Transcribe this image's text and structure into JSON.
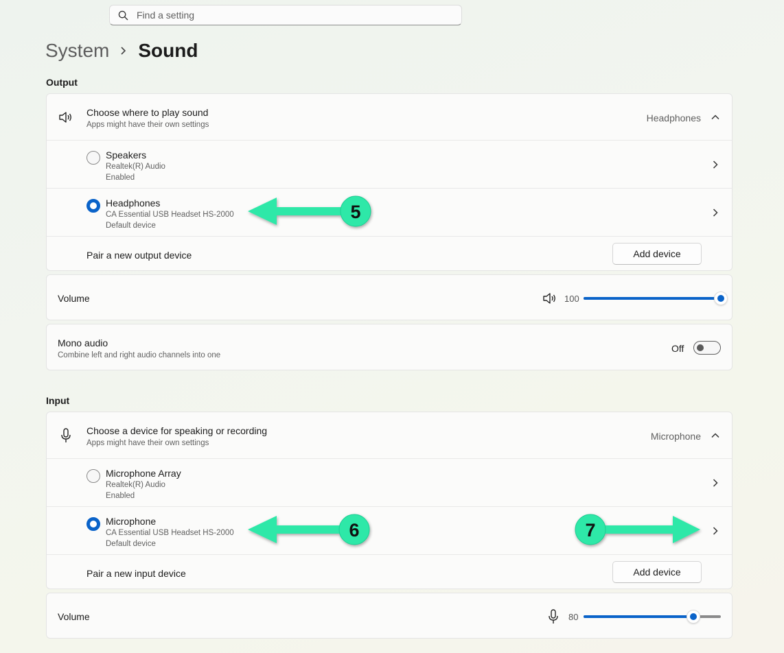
{
  "search": {
    "placeholder": "Find a setting"
  },
  "breadcrumb": {
    "parent": "System",
    "current": "Sound"
  },
  "output": {
    "section_label": "Output",
    "choose": {
      "title": "Choose where to play sound",
      "subtitle": "Apps might have their own settings",
      "value": "Headphones"
    },
    "devices": [
      {
        "name": "Speakers",
        "driver": "Realtek(R) Audio",
        "status": "Enabled",
        "selected": false
      },
      {
        "name": "Headphones",
        "driver": "CA Essential USB Headset HS-2000",
        "status": "Default device",
        "selected": true
      }
    ],
    "pair": {
      "label": "Pair a new output device",
      "button": "Add device"
    },
    "volume": {
      "label": "Volume",
      "value": "100",
      "level": 100
    },
    "mono": {
      "title": "Mono audio",
      "subtitle": "Combine left and right audio channels into one",
      "state": "Off"
    }
  },
  "input": {
    "section_label": "Input",
    "choose": {
      "title": "Choose a device for speaking or recording",
      "subtitle": "Apps might have their own settings",
      "value": "Microphone"
    },
    "devices": [
      {
        "name": "Microphone Array",
        "driver": "Realtek(R) Audio",
        "status": "Enabled",
        "selected": false
      },
      {
        "name": "Microphone",
        "driver": "CA Essential USB Headset HS-2000",
        "status": "Default device",
        "selected": true
      }
    ],
    "pair": {
      "label": "Pair a new input device",
      "button": "Add device"
    },
    "volume": {
      "label": "Volume",
      "value": "80",
      "level": 80
    }
  },
  "annotations": {
    "badge_5": "5",
    "badge_6": "6",
    "badge_7": "7"
  },
  "colors": {
    "accent": "#0a63c9",
    "annotation": "#2de8a8"
  },
  "icons": [
    "search-icon",
    "speaker-icon",
    "microphone-icon",
    "chevron-up-icon",
    "chevron-right-icon"
  ]
}
